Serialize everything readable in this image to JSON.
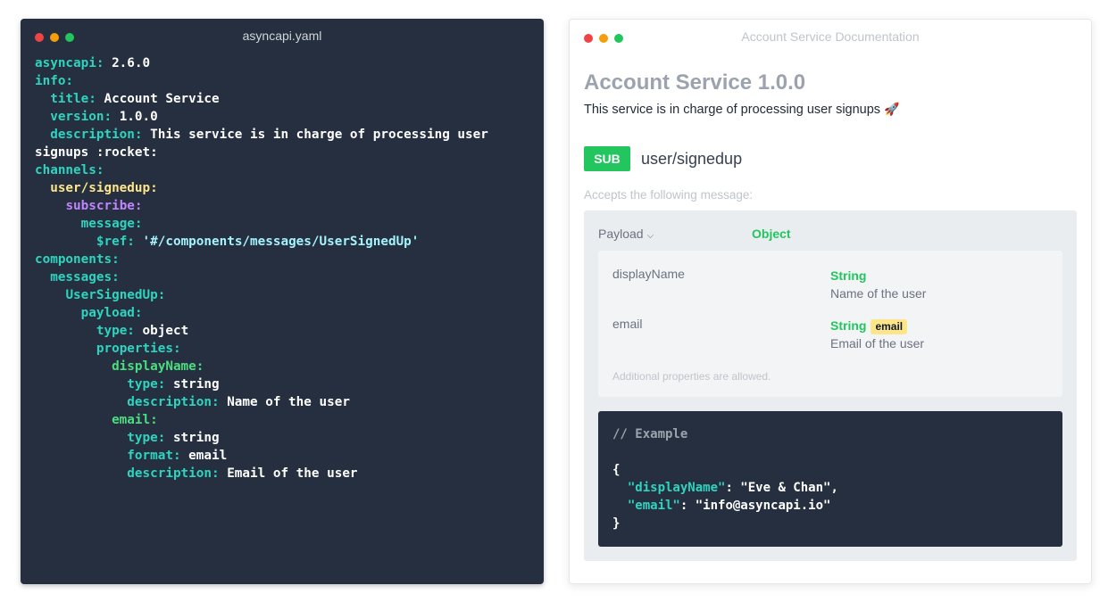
{
  "editor": {
    "title": "asyncapi.yaml",
    "lines": {
      "l1k": "asyncapi:",
      "l1v": " 2.6.0",
      "l2k": "info:",
      "l3k": "title:",
      "l3v": " Account Service",
      "l4k": "version:",
      "l4v": " 1.0.0",
      "l5k": "description:",
      "l5v": " This service is in charge of processing user",
      "l6v": "signups :rocket:",
      "l7k": "channels:",
      "l8k": "user/signedup:",
      "l9k": "subscribe:",
      "l10k": "message:",
      "l11k": "$ref:",
      "l11v": " '#/components/messages/UserSignedUp'",
      "l12k": "components:",
      "l13k": "messages:",
      "l14k": "UserSignedUp:",
      "l15k": "payload:",
      "l16k": "type:",
      "l16v": " object",
      "l17k": "properties:",
      "l18k": "displayName:",
      "l19k": "type:",
      "l19v": " string",
      "l20k": "description:",
      "l20v": " Name of the user",
      "l21k": "email:",
      "l22k": "type:",
      "l22v": " string",
      "l23k": "format:",
      "l23v": " email",
      "l24k": "description:",
      "l24v": " Email of the user"
    }
  },
  "docs": {
    "window_title": "Account Service Documentation",
    "heading": "Account Service 1.0.0",
    "description": "This service is in charge of processing user signups",
    "rocket": "🚀",
    "operation_badge": "SUB",
    "channel": "user/signedup",
    "accepts_text": "Accepts the following message:",
    "payload_label": "Payload",
    "payload_type": "Object",
    "properties": [
      {
        "name": "displayName",
        "type": "String",
        "description": "Name of the user"
      },
      {
        "name": "email",
        "type": "String",
        "format": "email",
        "description": "Email of the user"
      }
    ],
    "additional_text": "Additional properties are allowed.",
    "example": {
      "comment": "// Example",
      "open": "{",
      "key1": "\"displayName\"",
      "val1": ": \"Eve & Chan\",",
      "key2": "\"email\"",
      "val2": ": \"info@asyncapi.io\"",
      "close": "}"
    }
  },
  "colors": {
    "editor_bg": "#252f3f",
    "key_teal": "#2dd4bf",
    "key_green": "#4ade80",
    "key_yellow": "#fde68a",
    "key_purple": "#c084fc",
    "badge_green": "#22c55e",
    "format_badge": "#fde68a"
  }
}
